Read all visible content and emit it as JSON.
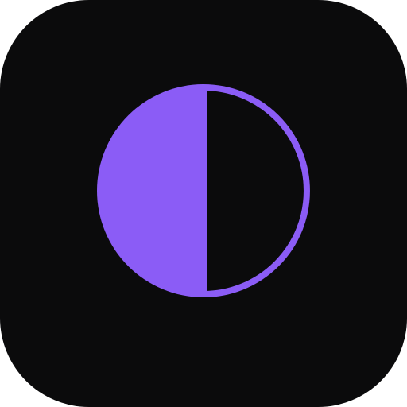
{
  "app_icon": {
    "name": "contrast-theme-icon",
    "background_color": "#0b0b0c",
    "accent_color": "#8b5cf6",
    "inner_color": "#0b0b0c"
  }
}
